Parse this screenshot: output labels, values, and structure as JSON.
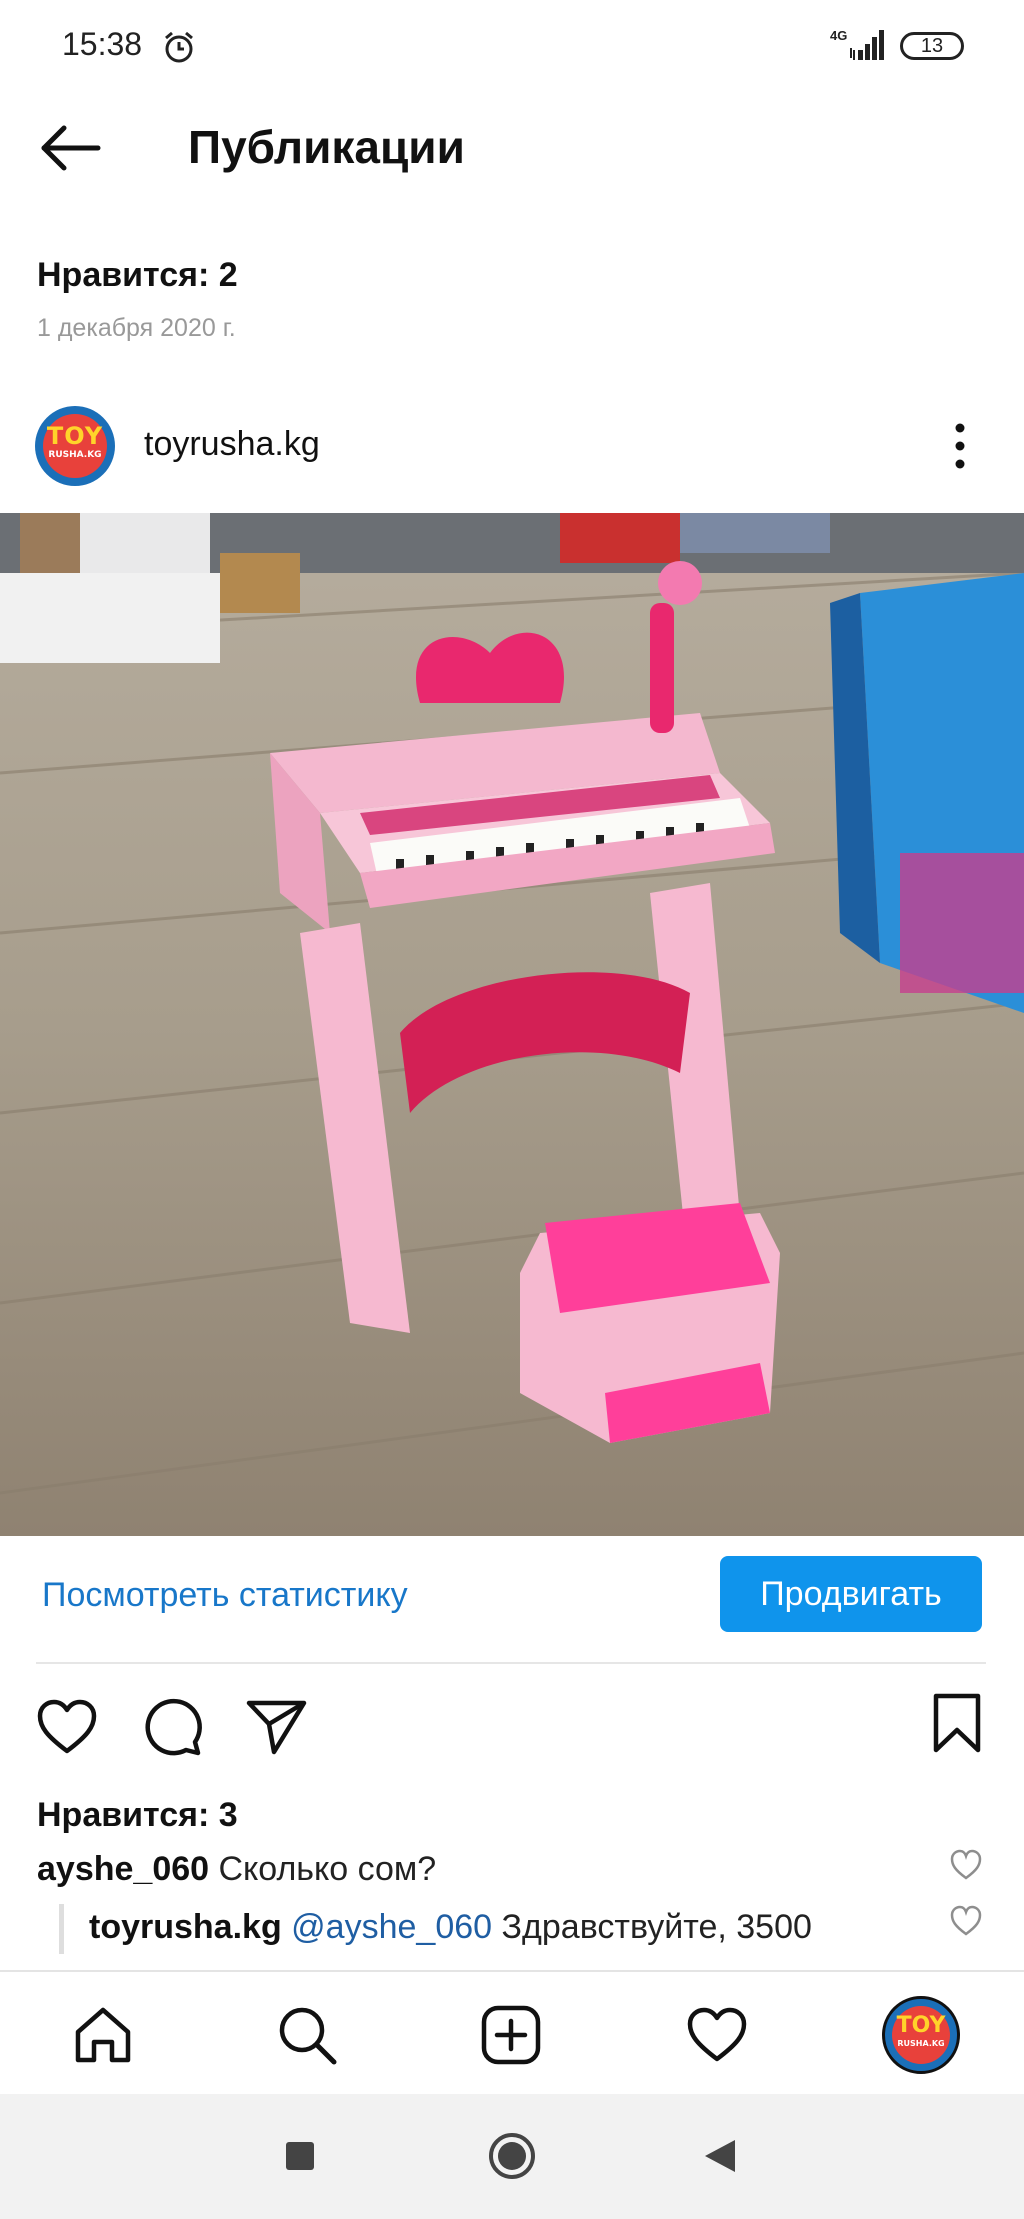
{
  "status_bar": {
    "time": "15:38",
    "network": "4G",
    "battery": "13"
  },
  "header": {
    "back_icon": "arrow-left-icon",
    "title": "Публикации"
  },
  "post_info": {
    "likes_label": "Нравится: 2",
    "date": "1 декабря 2020 г."
  },
  "post": {
    "username": "toyrusha.kg",
    "avatar_text_top": "TOY",
    "avatar_text_bottom": "RUSHA.KG",
    "stats_link": "Посмотреть статистику",
    "promote_button": "Продвигать",
    "likes": "Нравится: 3",
    "comments": [
      {
        "user": "ayshe_060",
        "text": "Сколько сом?"
      },
      {
        "user": "toyrusha.kg",
        "mention": "@ayshe_060",
        "text": "Здравствуйте, 3500"
      }
    ]
  },
  "colors": {
    "accent": "#0f94ec",
    "link": "#1877c9",
    "mention": "#1f5ea3"
  },
  "icons": {
    "like": "heart-icon",
    "comment": "comment-icon",
    "share": "send-icon",
    "save": "bookmark-icon",
    "home": "home-icon",
    "search": "search-icon",
    "add": "add-post-icon",
    "activity": "heart-icon"
  }
}
